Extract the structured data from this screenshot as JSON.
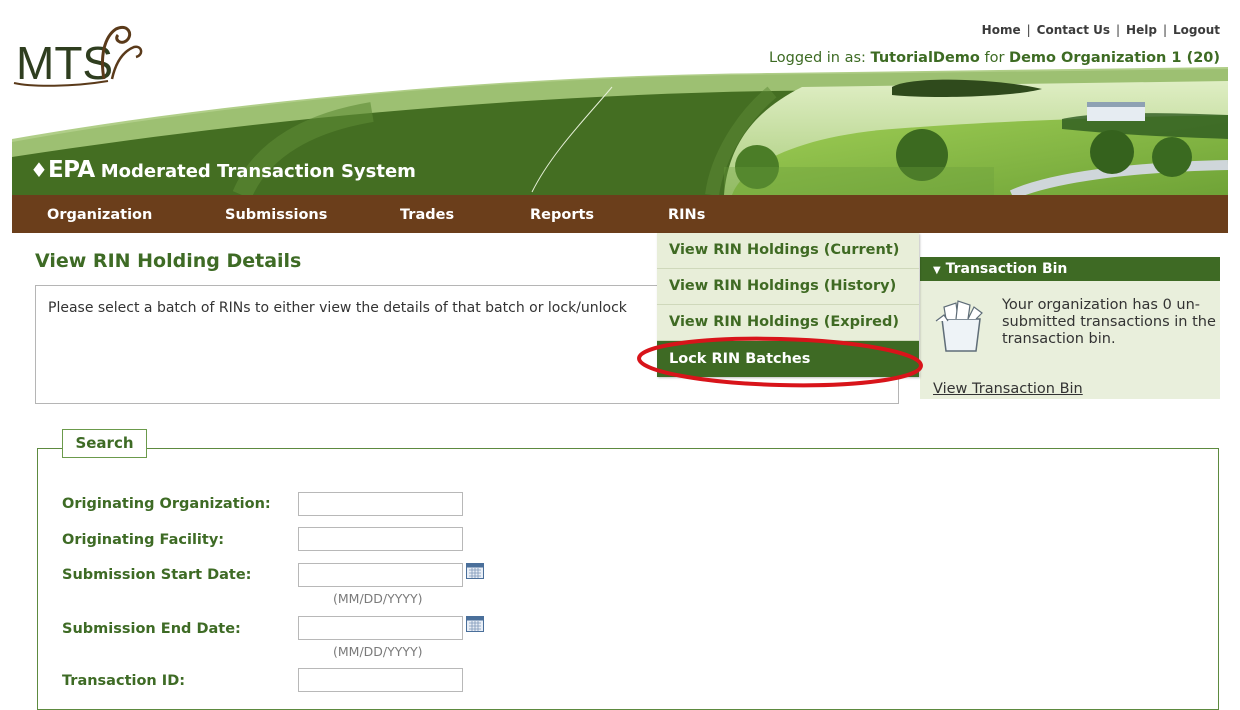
{
  "header": {
    "links": [
      "Home",
      "Contact Us",
      "Help",
      "Logout"
    ],
    "logged_prefix": "Logged in as:",
    "user": "TutorialDemo",
    "logged_for": "for",
    "organization": "Demo Organization 1 (20)",
    "logo_text": "MTS",
    "epa_mark": "EPA",
    "system_name": "Moderated Transaction System"
  },
  "nav": {
    "items": [
      "Organization",
      "Submissions",
      "Trades",
      "Reports",
      "RINs"
    ]
  },
  "dropdown": {
    "items": [
      "View RIN Holdings (Current)",
      "View RIN Holdings (History)",
      "View RIN Holdings (Expired)",
      "Lock RIN Batches"
    ],
    "active_index": 3
  },
  "page": {
    "title": "View RIN Holding Details",
    "info": "Please select a batch of RINs to either view the details of that batch or lock/unlock"
  },
  "transaction_bin": {
    "title": "Transaction Bin",
    "text": "Your organization has 0 un-submitted transactions in the transaction bin.",
    "link": "View Transaction Bin"
  },
  "search": {
    "tab": "Search",
    "fields": {
      "orig_org": "Originating Organization:",
      "orig_facility": "Originating Facility:",
      "start_date": "Submission Start Date:",
      "end_date": "Submission End Date:",
      "transaction_id": "Transaction ID:"
    },
    "date_hint": "(MM/DD/YYYY)"
  },
  "colors": {
    "brand_green": "#3e6a24",
    "nav_brown": "#6b3e1b",
    "highlight_red": "#d8141a"
  }
}
